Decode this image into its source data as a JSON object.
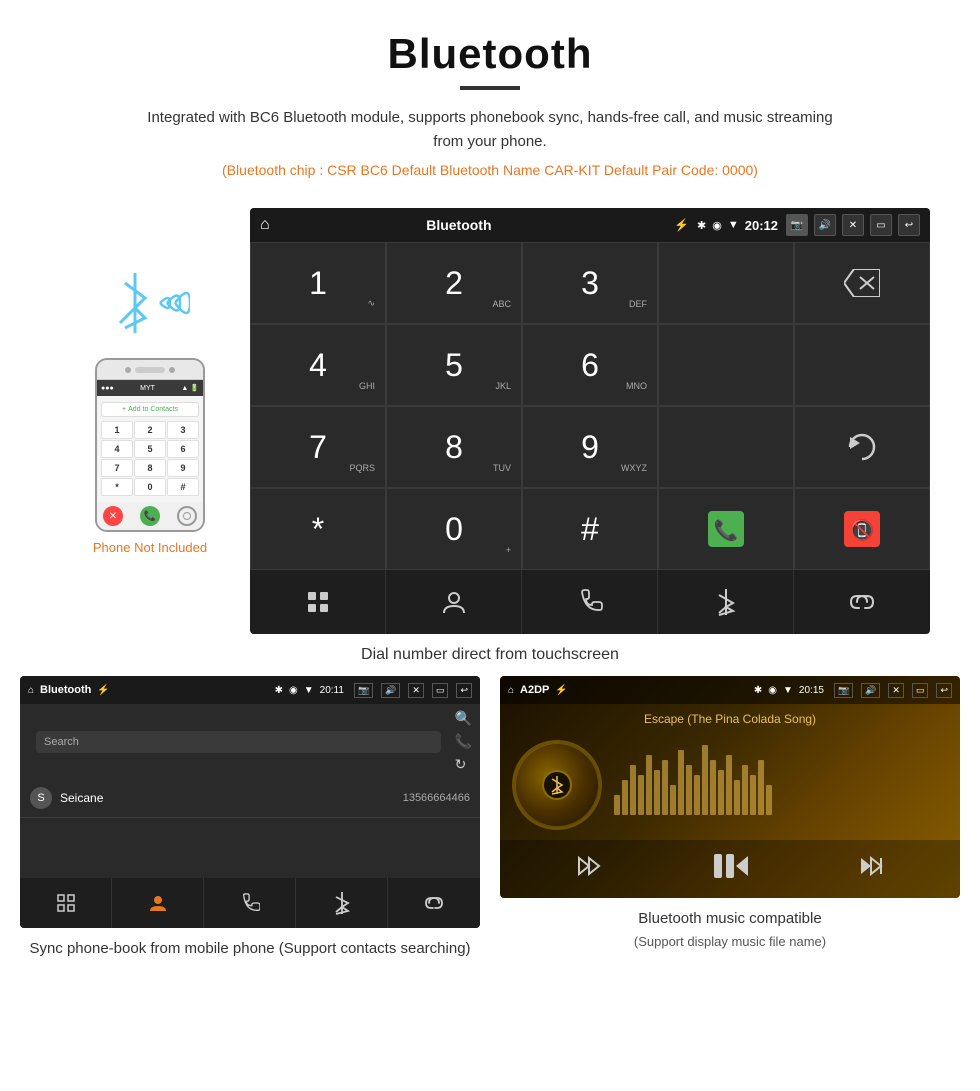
{
  "header": {
    "title": "Bluetooth",
    "description": "Integrated with BC6 Bluetooth module, supports phonebook sync, hands-free call, and music streaming from your phone.",
    "specs": "(Bluetooth chip : CSR BC6    Default Bluetooth Name CAR-KIT    Default Pair Code: 0000)"
  },
  "main_screen": {
    "status": {
      "title": "Bluetooth",
      "time": "20:12",
      "usb_icon": "⚡"
    },
    "dial_keys": [
      {
        "number": "1",
        "sub": ""
      },
      {
        "number": "2",
        "sub": "ABC"
      },
      {
        "number": "3",
        "sub": "DEF"
      },
      {
        "number": "",
        "sub": ""
      },
      {
        "number": "",
        "sub": "backspace"
      },
      {
        "number": "4",
        "sub": "GHI"
      },
      {
        "number": "5",
        "sub": "JKL"
      },
      {
        "number": "6",
        "sub": "MNO"
      },
      {
        "number": "",
        "sub": ""
      },
      {
        "number": "",
        "sub": ""
      },
      {
        "number": "7",
        "sub": "PQRS"
      },
      {
        "number": "8",
        "sub": "TUV"
      },
      {
        "number": "9",
        "sub": "WXYZ"
      },
      {
        "number": "",
        "sub": ""
      },
      {
        "number": "",
        "sub": "redial"
      },
      {
        "number": "*",
        "sub": ""
      },
      {
        "number": "0",
        "sub": "+"
      },
      {
        "number": "#",
        "sub": ""
      },
      {
        "number": "",
        "sub": "call-green"
      },
      {
        "number": "",
        "sub": "call-red"
      }
    ],
    "toolbar": [
      "grid",
      "person",
      "phone",
      "bluetooth",
      "link"
    ]
  },
  "main_caption": "Dial number direct from touchscreen",
  "phonebook_screen": {
    "status": {
      "title": "Bluetooth",
      "time": "20:11"
    },
    "search_placeholder": "Search",
    "contacts": [
      {
        "letter": "S",
        "name": "Seicane",
        "number": "13566664466"
      }
    ],
    "toolbar": [
      "grid",
      "person",
      "phone",
      "bluetooth",
      "link"
    ]
  },
  "phonebook_caption": "Sync phone-book from mobile phone\n(Support contacts searching)",
  "music_screen": {
    "status": {
      "title": "A2DP",
      "time": "20:15"
    },
    "song_title": "Escape (The Pina Colada Song)",
    "eq_bars": [
      20,
      35,
      50,
      40,
      60,
      45,
      55,
      30,
      65,
      50,
      40,
      70,
      55,
      45,
      60,
      35,
      50,
      40,
      55,
      30
    ],
    "controls": [
      "prev",
      "play-pause",
      "next"
    ]
  },
  "music_caption": "Bluetooth music compatible\n(Support display music file name)"
}
